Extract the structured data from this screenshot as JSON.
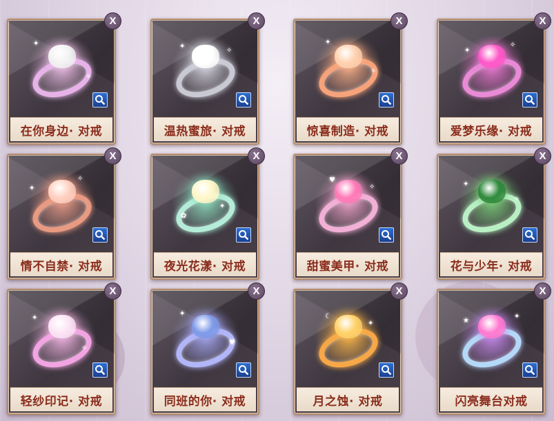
{
  "rings": [
    {
      "name": "在你身边· 对戒",
      "glow": "#f3c3ec",
      "band": "#e6b2e8",
      "gem": "#f2f2f2"
    },
    {
      "name": "温热蜜旅· 对戒",
      "glow": "#d9d9e3",
      "band": "#c9c9d4",
      "gem": "#ffffff"
    },
    {
      "name": "惊喜制造· 对戒",
      "glow": "#ffb38a",
      "band": "#f6a27a",
      "gem": "#ffd2b0"
    },
    {
      "name": "爱梦乐缘· 对戒",
      "glow": "#f07ad6",
      "band": "#e98ad6",
      "gem": "#ff58c8"
    },
    {
      "name": "情不自禁· 对戒",
      "glow": "#f0a08a",
      "band": "#e89a82",
      "gem": "#ffd0c0"
    },
    {
      "name": "夜光花漾· 对戒",
      "glow": "#8fe0c0",
      "band": "#b4ecd8",
      "gem": "#fff6c8"
    },
    {
      "name": "甜蜜美甲· 对戒",
      "glow": "#f5a6cf",
      "band": "#f2b0d6",
      "gem": "#ff7ab8"
    },
    {
      "name": "花与少年· 对戒",
      "glow": "#7bd07a",
      "band": "#b8f0c4",
      "gem": "#2f8a3c"
    },
    {
      "name": "轻纱印记· 对戒",
      "glow": "#f6b8e6",
      "band": "#f2a4e2",
      "gem": "#fbe4f4"
    },
    {
      "name": "同班的你· 对戒",
      "glow": "#a6a8f4",
      "band": "#b2b6f8",
      "gem": "#7f9ae8"
    },
    {
      "name": "月之蚀· 对戒",
      "glow": "#ffb84a",
      "band": "#f6a848",
      "gem": "#ffd26a"
    },
    {
      "name": "闪亮舞台对戒",
      "glow": "#c88af0",
      "band": "#b4d8f8",
      "gem": "#ff7ad0"
    }
  ],
  "close_label": "X"
}
